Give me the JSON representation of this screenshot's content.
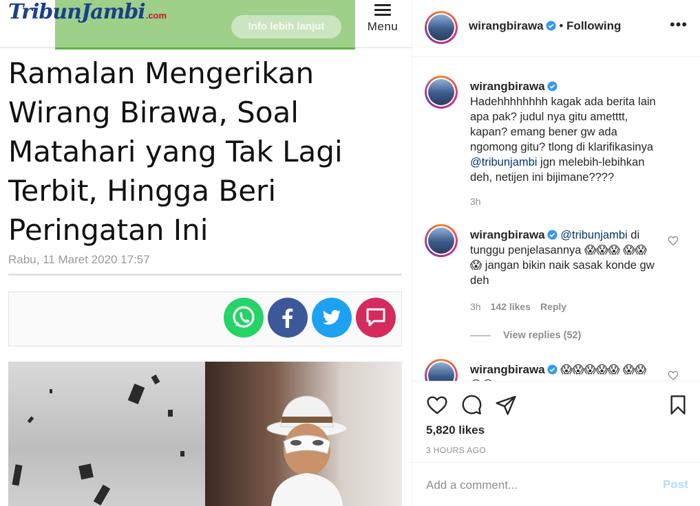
{
  "article": {
    "logo_main": "TribunJambi",
    "logo_suffix": ".com",
    "banner_button": "Info lebih lanjut",
    "menu_label": "Menu",
    "title": "Ramalan Mengerikan Wirang Birawa, Soal Matahari yang Tak Lagi Terbit, Hingga Beri Peringatan Ini",
    "date": "Rabu, 11 Maret 2020 17:57",
    "share_icons": [
      "whatsapp-icon",
      "facebook-icon",
      "twitter-icon",
      "comment-icon"
    ],
    "share_colors": {
      "whatsapp": "#25d366",
      "facebook": "#3b5998",
      "twitter": "#1da1f2",
      "comment": "#d52b5c"
    }
  },
  "instagram": {
    "header": {
      "username": "wirangbirawa",
      "separator": " • ",
      "follow_state": "Following"
    },
    "comments": [
      {
        "username": "wirangbirawa",
        "pre": "Hadehhhhhhhh kagak ada berita lain apa pak? judul nya gitu ametttt, kapan? emang bener gw ada ngomong gitu? tlong di klarifikasinya ",
        "mention": "@tribunjambi",
        "post": " jgn melebih-lebihkan deh, netijen ini bijimane????",
        "time": "3h"
      },
      {
        "username": "wirangbirawa",
        "pre": " ",
        "mention": "@tribunjambi",
        "post": " di tunggu penjelasannya 😱😱😱 😱😱😱 jangan bikin naik sasak konde gw deh",
        "time": "3h",
        "likes": "142 likes",
        "reply": "Reply",
        "view_replies": "View replies (52)"
      },
      {
        "username": "wirangbirawa",
        "pre": " 😱😱😱😱😱 😱😱😱😱",
        "mention": "",
        "post": ""
      }
    ],
    "likes": "5,820 likes",
    "time_ago": "3 HOURS AGO",
    "comment_placeholder": "Add a comment...",
    "post_label": "Post",
    "accent_colors": {
      "link": "#00376b",
      "verified": "#3897f0",
      "post_disabled": "#b2dffc"
    }
  }
}
